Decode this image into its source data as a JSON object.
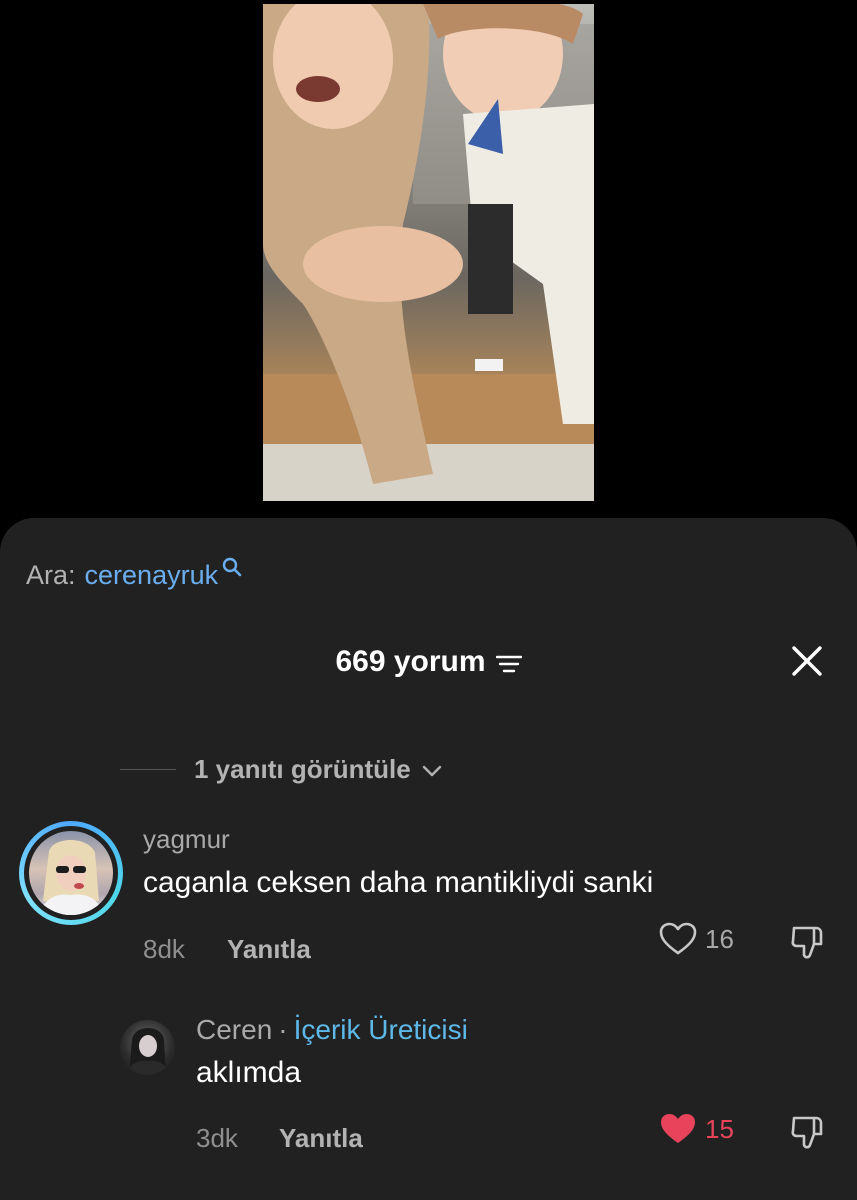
{
  "search": {
    "prefix": "Ara:",
    "term": "cerenayruk",
    "icon": "search-icon"
  },
  "header": {
    "count_label": "669 yorum",
    "filter_icon": "filter-icon",
    "close_icon": "close-icon"
  },
  "thread": {
    "view_replies_label": "1 yanıtı görüntüle"
  },
  "comments": [
    {
      "username": "yagmur",
      "text": "caganla ceksen daha mantikliydi sanki",
      "time": "8dk",
      "reply_label": "Yanıtla",
      "likes": "16",
      "liked": false
    },
    {
      "username": "Ceren",
      "badge": "İçerik Üreticisi",
      "separator": "·",
      "text": "aklımda",
      "time": "3dk",
      "reply_label": "Yanıtla",
      "likes": "15",
      "liked": true
    }
  ],
  "colors": {
    "sheet_bg": "#212121",
    "search_term": "#6aaef0",
    "creator_badge": "#5db8e8",
    "liked_heart": "#e8435a"
  }
}
